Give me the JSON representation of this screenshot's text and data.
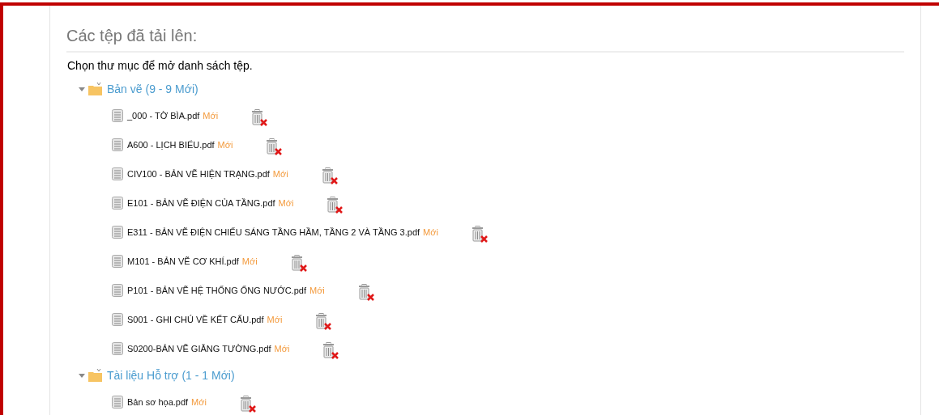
{
  "section": {
    "title": "Các tệp đã tải lên:",
    "instruction": "Chọn thư mục để mở danh sách tệp."
  },
  "folders": [
    {
      "label": "Bản vẽ (9 - 9 Mới)",
      "expanded": true,
      "files": [
        {
          "name": "_000 - TỜ BÌA.pdf",
          "badge": "Mới"
        },
        {
          "name": "A600 - LỊCH BIỂU.pdf",
          "badge": "Mới"
        },
        {
          "name": "CIV100 - BẢN VẼ HIỆN TRẠNG.pdf",
          "badge": "Mới"
        },
        {
          "name": "E101 - BẢN VẼ ĐIỆN CỦA TẦNG.pdf",
          "badge": "Mới"
        },
        {
          "name": "E311 - BẢN VẼ ĐIỆN CHIẾU SÁNG TẦNG HẦM, TẦNG 2 VÀ TẦNG 3.pdf",
          "badge": "Mới"
        },
        {
          "name": "M101 - BẢN VẼ CƠ KHÍ.pdf",
          "badge": "Mới"
        },
        {
          "name": "P101 - BẢN VẼ HỆ THỐNG ỐNG NƯỚC.pdf",
          "badge": "Mới"
        },
        {
          "name": "S001 - GHI CHÚ VỀ KẾT CẤU.pdf",
          "badge": "Mới"
        },
        {
          "name": "S0200-BẢN VẼ GIẰNG TƯỜNG.pdf",
          "badge": "Mới"
        }
      ]
    },
    {
      "label": "Tài liệu Hỗ trợ (1 - 1 Mới)",
      "expanded": true,
      "files": [
        {
          "name": "Bản sơ họa.pdf",
          "badge": "Mới"
        }
      ]
    }
  ]
}
